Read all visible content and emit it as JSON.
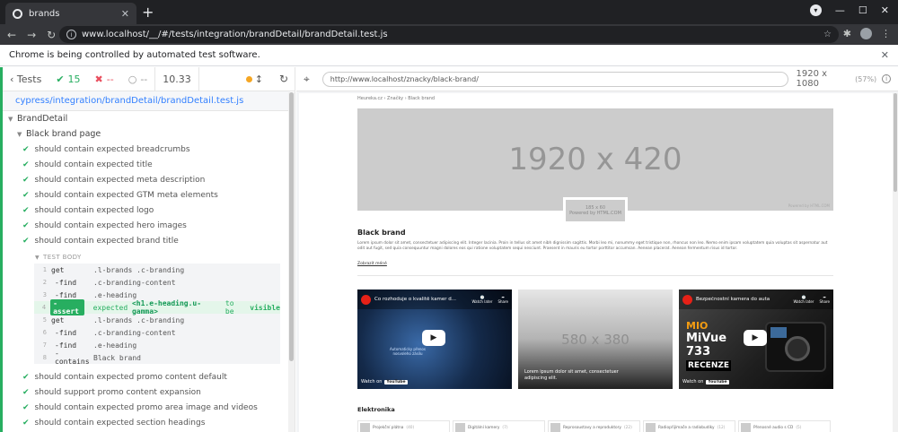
{
  "browser": {
    "tab_title": "brands",
    "url": "www.localhost/__/#/tests/integration/brandDetail/brandDetail.test.js",
    "infobar_text": "Chrome is being controlled by automated test software."
  },
  "reporter": {
    "tests_label": "Tests",
    "passed": "15",
    "failed": "--",
    "pending": "--",
    "duration": "10.33",
    "spec_path": "cypress/integration/brandDetail/brandDetail.test.js",
    "suite": "BrandDetail",
    "subsuite": "Black brand page",
    "tests_before": [
      "should contain expected breadcrumbs",
      "should contain expected title",
      "should contain expected meta description",
      "should contain expected GTM meta elements",
      "should contain expected logo",
      "should contain expected hero images",
      "should contain expected brand title"
    ],
    "test_body_label": "TEST BODY",
    "commands": [
      {
        "num": "1",
        "name": "get",
        "msg": ".l-brands .c-branding"
      },
      {
        "num": "2",
        "name": "-find",
        "msg": ".c-branding-content"
      },
      {
        "num": "3",
        "name": "-find",
        "msg": ".e-heading"
      },
      {
        "num": "4",
        "name": "-assert",
        "msg_expected": "expected",
        "msg_el": "<h1.e-heading.u-gamma>",
        "msg_tobe": "to be",
        "msg_state": "visible"
      },
      {
        "num": "5",
        "name": "get",
        "msg": ".l-brands .c-branding"
      },
      {
        "num": "6",
        "name": "-find",
        "msg": ".c-branding-content"
      },
      {
        "num": "7",
        "name": "-find",
        "msg": ".e-heading"
      },
      {
        "num": "8",
        "name": "-contains",
        "msg": "Black brand"
      }
    ],
    "tests_after": [
      "should contain expected promo content default",
      "should support promo content expansion",
      "should contain expected promo area image and videos",
      "should contain expected section headings"
    ]
  },
  "aut": {
    "url": "http://www.localhost/znacky/black-brand/",
    "viewport": "1920 x 1080",
    "scale": "(57%)",
    "breadcrumbs": "Heureka.cz  ›  Značky  ›  Black brand",
    "hero_text": "1920 x 420",
    "hero_credit": "Powered by HTML.COM",
    "logo_text1": "185 x 60",
    "logo_text2": "Powered by HTML.COM",
    "brand_title": "Black brand",
    "brand_desc": "Lorem ipsum dolor sit amet, consectetuer adipiscing elit. Integer lacinia. Proin in tellus sit amet nibh dignissim sagittis. Morbi leo mi, nonummy eget tristique non, rhoncus non leo. Nemo enim ipsam voluptatem quia voluptas sit aspernatur aut odit aut fugit, sed quia consequuntur magni dolores eos qui ratione voluptatem sequi nesciunt. Praesent in mauris eu tortor porttitor accumsan. Aenean placerat. Aenean fermentum risus id tortor.",
    "more_link": "Zobrazit méně",
    "video1_title": "Co rozhoduje o kvalitě kamer d...",
    "video1_caption": "Automaticky přenos nosvoleho zásilu",
    "video2_title": "Bezpečnostní kamera do auta",
    "watch_later": "Watch later",
    "share": "Share",
    "watch_on": "Watch on",
    "youtube": "YouTube",
    "img_text": "580 x 380",
    "img_caption": "Lorem ipsum dolor sit amet, consectetuer adipiscing elit.",
    "mivue": {
      "brand": "MIO",
      "l2": "MiVue",
      "l3": "733",
      "l4": "RECENZE"
    },
    "section_title": "Elektronika",
    "categories": [
      {
        "name": "Projekční plátna",
        "count": "(40)"
      },
      {
        "name": "Digitální kamery",
        "count": "(7)"
      },
      {
        "name": "Reprosoustavy a reproduktory",
        "count": "(22)"
      },
      {
        "name": "Radiopřijímače a radiobudíky",
        "count": "(12)"
      },
      {
        "name": "Přenosné audio s CD",
        "count": "(5)"
      }
    ]
  }
}
